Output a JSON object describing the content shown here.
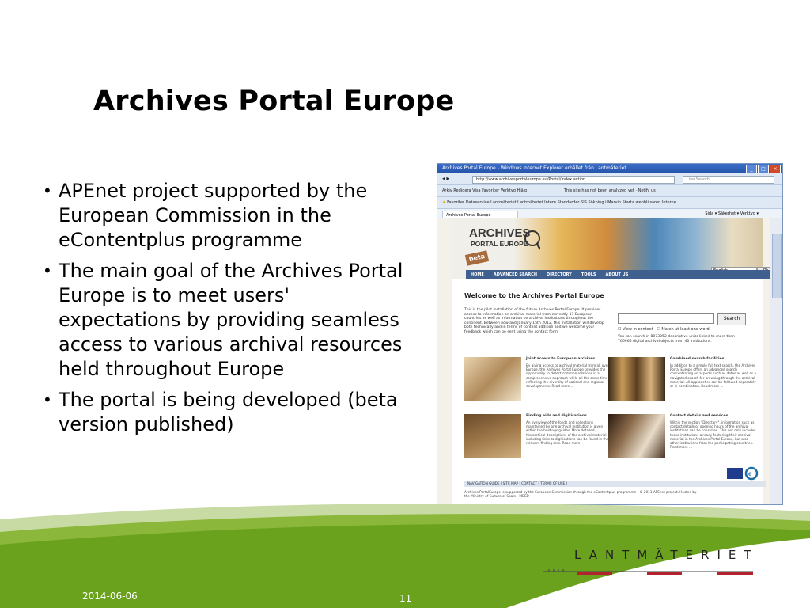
{
  "slide": {
    "title": "Archives Portal Europe",
    "bullets": [
      "APEnet project supported by the European Commission in the eContentplus programme",
      "The main goal of the Archives Portal Europe is to meet users' expectations by providing seamless access to various archival resources held throughout Europe",
      "The portal is being developed (beta version published)"
    ],
    "date": "2014-06-06",
    "page_number": "11",
    "logo_text": "LANTMÄTERIET"
  },
  "browser": {
    "window_title": "Archives Portal Europe - Windows Internet Explorer erhållet från Lantmäteriet",
    "address": "http://www.archivesportaleurope.eu/Portal/index.action",
    "search_placeholder": "Live Search",
    "menu": "Arkiv   Redigera   Visa   Favoriter   Verktyg   Hjälp",
    "toolbar": "This site has not been analyzed yet  ·  Notify us",
    "favorites": "Favoriter   Dataservice   Lantmäteriet   Lantmäteriet Intern   Standarder SIS   Sökning i Marvin   Starta webbläsaren Interne...",
    "tab_label": "Archives Portal Europe",
    "cmd_bar": "Sida ▾   Säkerhet ▾   Verktyg ▾"
  },
  "portal": {
    "logo_line1": "ARCHIVES",
    "logo_line2": "PORTAL EUROPE",
    "beta": "beta",
    "nav": [
      "HOME",
      "ADVANCED SEARCH",
      "DIRECTORY",
      "TOOLS",
      "ABOUT US"
    ],
    "language": "English",
    "ok": "Ok",
    "welcome": "Welcome to the Archives Portal Europe",
    "intro": "This is the pilot installation of the future Archives Portal Europe. It provides access to information on archival material from currently 17 European countries as well as information on archival institutions throughout the continent. Between now and January 15th 2012, this installation will develop both technically and in terms of content addition and we welcome your feedback which can be sent using the contact form.",
    "search_button": "Search",
    "opt1": "View in context",
    "opt2": "Match at least one word",
    "search_note": "You can search in 8073052 descriptive units linked to more than 766966 digital archival objects from 40 institutions.",
    "blocks": [
      {
        "title": "Joint access to European archives",
        "text": "By giving access to archival material from all over Europe, the Archives Portal Europe provides the opportunity to detect common relations in a comprehensive approach while all the same time reflecting the diversity of national and regional developments. Read more ..."
      },
      {
        "title": "Combined search facilities",
        "text": "In addition to a simple full text search, the Archives Portal Europe offers an advanced search concentrating on aspects such as dates as well as a navigated search for browsing through the archival material. All approaches can be followed separately or in combination. Read more ..."
      },
      {
        "title": "Finding aids and digitisations",
        "text": "An overview of the fonds and collections maintained by one archival institution is given within the holdings guides. More detailed, hierarchical descriptions of the archival material including links to digitisations can be found in the relevant finding aids. Read more"
      },
      {
        "title": "Contact details and services",
        "text": "Within the section \"Directory\", information such as contact details or opening hours of the archival institutions can be consulted. This not only includes those institutions already featuring their archival material in the Archives Portal Europe, but also other institutions from the participating countries. Read more ..."
      }
    ],
    "footer_nav": "NAVIGATION GUIDE  |  SITE MAP  |  CONTACT  |  TERMS OF USE  |",
    "footer_text": "Archives PortalEurope is supported by the European Commission through the eContentplus programme - © 2011 APEnet project. Hosted by the Ministry of Culture of Spain - MECD"
  }
}
